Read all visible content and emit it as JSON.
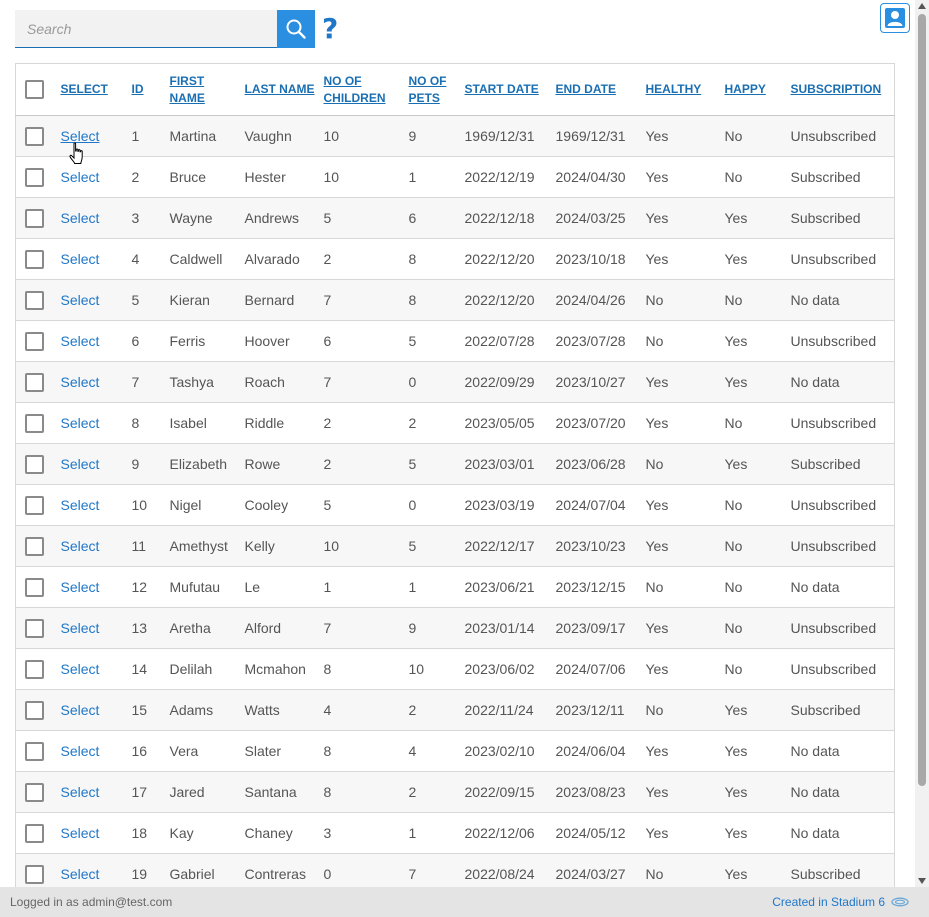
{
  "search": {
    "placeholder": "Search"
  },
  "help": {
    "label": "?"
  },
  "table": {
    "headers": [
      {
        "key": "select",
        "label": "SELECT"
      },
      {
        "key": "id",
        "label": "ID"
      },
      {
        "key": "first_name",
        "label": "FIRST NAME"
      },
      {
        "key": "last_name",
        "label": "LAST NAME"
      },
      {
        "key": "children",
        "label": "NO OF CHILDREN"
      },
      {
        "key": "pets",
        "label": "NO OF PETS"
      },
      {
        "key": "start_date",
        "label": "START DATE"
      },
      {
        "key": "end_date",
        "label": "END DATE"
      },
      {
        "key": "healthy",
        "label": "HEALTHY"
      },
      {
        "key": "happy",
        "label": "HAPPY"
      },
      {
        "key": "subscription",
        "label": "SUBSCRIPTION"
      }
    ],
    "rows": [
      {
        "select": "Select",
        "id": "1",
        "first_name": "Martina",
        "last_name": "Vaughn",
        "children": "10",
        "pets": "9",
        "start_date": "1969/12/31",
        "end_date": "1969/12/31",
        "healthy": "Yes",
        "happy": "No",
        "subscription": "Unsubscribed"
      },
      {
        "select": "Select",
        "id": "2",
        "first_name": "Bruce",
        "last_name": "Hester",
        "children": "10",
        "pets": "1",
        "start_date": "2022/12/19",
        "end_date": "2024/04/30",
        "healthy": "Yes",
        "happy": "No",
        "subscription": "Subscribed"
      },
      {
        "select": "Select",
        "id": "3",
        "first_name": "Wayne",
        "last_name": "Andrews",
        "children": "5",
        "pets": "6",
        "start_date": "2022/12/18",
        "end_date": "2024/03/25",
        "healthy": "Yes",
        "happy": "Yes",
        "subscription": "Subscribed"
      },
      {
        "select": "Select",
        "id": "4",
        "first_name": "Caldwell",
        "last_name": "Alvarado",
        "children": "2",
        "pets": "8",
        "start_date": "2022/12/20",
        "end_date": "2023/10/18",
        "healthy": "Yes",
        "happy": "Yes",
        "subscription": "Unsubscribed"
      },
      {
        "select": "Select",
        "id": "5",
        "first_name": "Kieran",
        "last_name": "Bernard",
        "children": "7",
        "pets": "8",
        "start_date": "2022/12/20",
        "end_date": "2024/04/26",
        "healthy": "No",
        "happy": "No",
        "subscription": "No data"
      },
      {
        "select": "Select",
        "id": "6",
        "first_name": "Ferris",
        "last_name": "Hoover",
        "children": "6",
        "pets": "5",
        "start_date": "2022/07/28",
        "end_date": "2023/07/28",
        "healthy": "No",
        "happy": "Yes",
        "subscription": "Unsubscribed"
      },
      {
        "select": "Select",
        "id": "7",
        "first_name": "Tashya",
        "last_name": "Roach",
        "children": "7",
        "pets": "0",
        "start_date": "2022/09/29",
        "end_date": "2023/10/27",
        "healthy": "Yes",
        "happy": "Yes",
        "subscription": "No data"
      },
      {
        "select": "Select",
        "id": "8",
        "first_name": "Isabel",
        "last_name": "Riddle",
        "children": "2",
        "pets": "2",
        "start_date": "2023/05/05",
        "end_date": "2023/07/20",
        "healthy": "Yes",
        "happy": "No",
        "subscription": "Unsubscribed"
      },
      {
        "select": "Select",
        "id": "9",
        "first_name": "Elizabeth",
        "last_name": "Rowe",
        "children": "2",
        "pets": "5",
        "start_date": "2023/03/01",
        "end_date": "2023/06/28",
        "healthy": "No",
        "happy": "Yes",
        "subscription": "Subscribed"
      },
      {
        "select": "Select",
        "id": "10",
        "first_name": "Nigel",
        "last_name": "Cooley",
        "children": "5",
        "pets": "0",
        "start_date": "2023/03/19",
        "end_date": "2024/07/04",
        "healthy": "Yes",
        "happy": "No",
        "subscription": "Unsubscribed"
      },
      {
        "select": "Select",
        "id": "11",
        "first_name": "Amethyst",
        "last_name": "Kelly",
        "children": "10",
        "pets": "5",
        "start_date": "2022/12/17",
        "end_date": "2023/10/23",
        "healthy": "Yes",
        "happy": "No",
        "subscription": "Unsubscribed"
      },
      {
        "select": "Select",
        "id": "12",
        "first_name": "Mufutau",
        "last_name": "Le",
        "children": "1",
        "pets": "1",
        "start_date": "2023/06/21",
        "end_date": "2023/12/15",
        "healthy": "No",
        "happy": "No",
        "subscription": "No data"
      },
      {
        "select": "Select",
        "id": "13",
        "first_name": "Aretha",
        "last_name": "Alford",
        "children": "7",
        "pets": "9",
        "start_date": "2023/01/14",
        "end_date": "2023/09/17",
        "healthy": "Yes",
        "happy": "No",
        "subscription": "Unsubscribed"
      },
      {
        "select": "Select",
        "id": "14",
        "first_name": "Delilah",
        "last_name": "Mcmahon",
        "children": "8",
        "pets": "10",
        "start_date": "2023/06/02",
        "end_date": "2024/07/06",
        "healthy": "Yes",
        "happy": "No",
        "subscription": "Unsubscribed"
      },
      {
        "select": "Select",
        "id": "15",
        "first_name": "Adams",
        "last_name": "Watts",
        "children": "4",
        "pets": "2",
        "start_date": "2022/11/24",
        "end_date": "2023/12/11",
        "healthy": "No",
        "happy": "Yes",
        "subscription": "Subscribed"
      },
      {
        "select": "Select",
        "id": "16",
        "first_name": "Vera",
        "last_name": "Slater",
        "children": "8",
        "pets": "4",
        "start_date": "2023/02/10",
        "end_date": "2024/06/04",
        "healthy": "Yes",
        "happy": "Yes",
        "subscription": "No data"
      },
      {
        "select": "Select",
        "id": "17",
        "first_name": "Jared",
        "last_name": "Santana",
        "children": "8",
        "pets": "2",
        "start_date": "2022/09/15",
        "end_date": "2023/08/23",
        "healthy": "Yes",
        "happy": "Yes",
        "subscription": "No data"
      },
      {
        "select": "Select",
        "id": "18",
        "first_name": "Kay",
        "last_name": "Chaney",
        "children": "3",
        "pets": "1",
        "start_date": "2022/12/06",
        "end_date": "2024/05/12",
        "healthy": "Yes",
        "happy": "Yes",
        "subscription": "No data"
      },
      {
        "select": "Select",
        "id": "19",
        "first_name": "Gabriel",
        "last_name": "Contreras",
        "children": "0",
        "pets": "7",
        "start_date": "2022/08/24",
        "end_date": "2024/03/27",
        "healthy": "No",
        "happy": "Yes",
        "subscription": "Subscribed"
      }
    ]
  },
  "footer": {
    "logged_in": "Logged in as admin@test.com",
    "created_in": "Created in Stadium 6"
  },
  "colors": {
    "accent": "#2a8fe0",
    "link": "#1f77c9"
  },
  "icons": {
    "search": "search-icon",
    "help": "help-icon",
    "user": "user-icon",
    "stadium": "stadium-logo-icon",
    "cursor": "hand-cursor-icon"
  }
}
